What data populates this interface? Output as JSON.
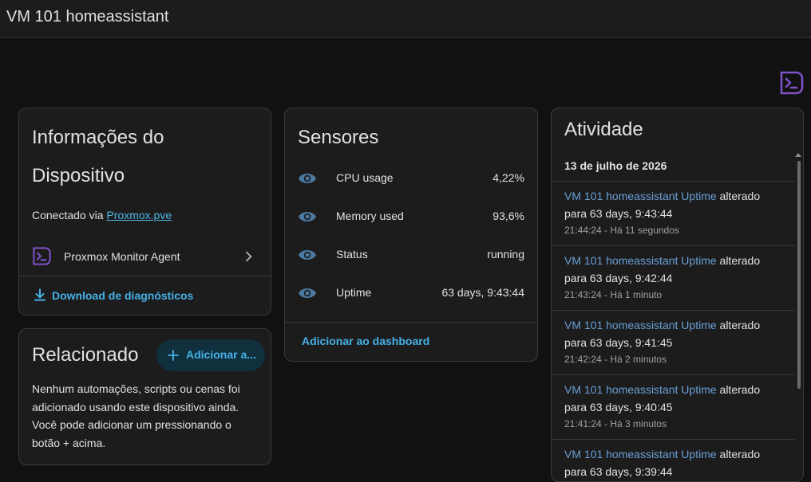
{
  "header": {
    "title": "VM 101 homeassistant"
  },
  "colors": {
    "accent": "#46b1e7",
    "integration_icon": "#7f52c9",
    "eye_icon": "#4b79a1",
    "log_entity": "#6a9fd6"
  },
  "device_info": {
    "title_line1": "Informações do",
    "title_line2": "Dispositivo",
    "connected_prefix": "Conectado via ",
    "connected_link": "Proxmox.pve",
    "integration_label": "Proxmox Monitor Agent",
    "download_label": "Download de diagnósticos"
  },
  "related": {
    "title": "Relacionado",
    "add_button": "Adicionar a...",
    "body": "Nenhum automações, scripts ou cenas foi adicionado usando este dispositivo ainda. Você pode adicionar um pressionando o botão + acima."
  },
  "sensors": {
    "title": "Sensores",
    "items": [
      {
        "label": "CPU usage",
        "value": "4,22%"
      },
      {
        "label": "Memory used",
        "value": "93,6%"
      },
      {
        "label": "Status",
        "value": "running"
      },
      {
        "label": "Uptime",
        "value": "63 days, 9:43:44"
      }
    ],
    "add_dashboard": "Adicionar ao dashboard"
  },
  "activity": {
    "title": "Atividade",
    "date": "13 de julho de 2026",
    "entries": [
      {
        "entity": "VM 101 homeassistant Uptime",
        "verb": " alterado",
        "line2": "para 63 days, 9:43:44",
        "time": "21:44:24 - Há 11 segundos"
      },
      {
        "entity": "VM 101 homeassistant Uptime",
        "verb": " alterado",
        "line2": "para 63 days, 9:42:44",
        "time": "21:43:24 - Há 1 minuto"
      },
      {
        "entity": "VM 101 homeassistant Uptime",
        "verb": " alterado",
        "line2": "para 63 days, 9:41:45",
        "time": "21:42:24 - Há 2 minutos"
      },
      {
        "entity": "VM 101 homeassistant Uptime",
        "verb": " alterado",
        "line2": "para 63 days, 9:40:45",
        "time": "21:41:24 - Há 3 minutos"
      },
      {
        "entity": "VM 101 homeassistant Uptime",
        "verb": " alterado",
        "line2": "para 63 days, 9:39:44",
        "time": ""
      }
    ]
  }
}
